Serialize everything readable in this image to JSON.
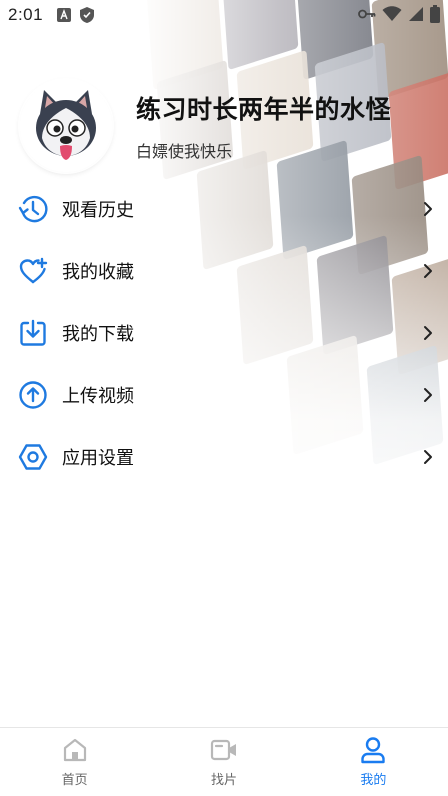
{
  "status_bar": {
    "time": "2:01",
    "left_icons": [
      "text-a-icon",
      "shield-icon"
    ],
    "right_icons": [
      "key-icon",
      "wifi-icon",
      "signal-icon",
      "battery-icon"
    ]
  },
  "profile": {
    "username": "练习时长两年半的水怪",
    "tagline": "白嫖使我快乐"
  },
  "menu": {
    "items": [
      {
        "label": "观看历史",
        "icon": "history-icon"
      },
      {
        "label": "我的收藏",
        "icon": "heart-plus-icon"
      },
      {
        "label": "我的下载",
        "icon": "download-icon"
      },
      {
        "label": "上传视频",
        "icon": "upload-icon"
      },
      {
        "label": "应用设置",
        "icon": "settings-icon"
      }
    ]
  },
  "bottom_nav": {
    "items": [
      {
        "label": "首页",
        "icon": "home-icon"
      },
      {
        "label": "找片",
        "icon": "video-camera-icon"
      },
      {
        "label": "我的",
        "icon": "user-icon"
      }
    ],
    "active": "我的"
  },
  "colors": {
    "accent": "#1a7cf0",
    "icon_blue": "#1f7ae0",
    "inactive_gray": "#b8b8b8"
  }
}
